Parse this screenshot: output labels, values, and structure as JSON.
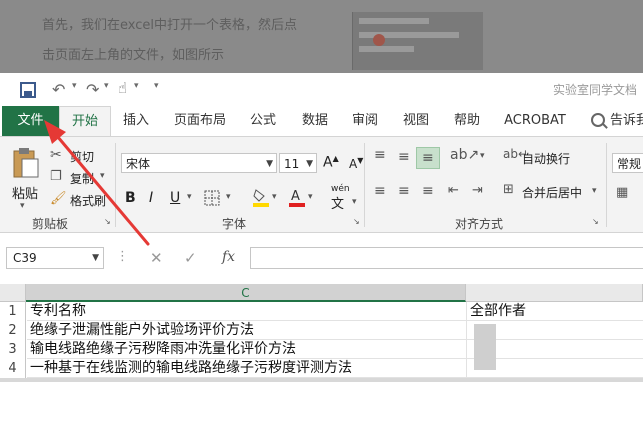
{
  "article": {
    "line1": "首先，我们在excel中打开一个表格，然后点",
    "line2": "击页面左上角的文件，如图所示"
  },
  "window": {
    "title": "实验室同学文档"
  },
  "tabs": [
    "文件",
    "开始",
    "插入",
    "页面布局",
    "公式",
    "数据",
    "审阅",
    "视图",
    "帮助",
    "ACROBAT",
    "告诉我"
  ],
  "clipboard": {
    "paste": "粘贴",
    "cut": "剪切",
    "copy": "复制",
    "format_painter": "格式刷",
    "group_label": "剪贴板"
  },
  "font": {
    "name": "宋体",
    "size": "11",
    "phonetic": "wén",
    "group_label": "字体"
  },
  "alignment": {
    "wrap_text": "自动换行",
    "merge_center": "合并后居中",
    "group_label": "对齐方式"
  },
  "number": {
    "format": "常规"
  },
  "formula_bar": {
    "name_box": "C39",
    "fx": "fx"
  },
  "grid": {
    "columns": [
      "C"
    ],
    "rows": [
      {
        "num": "1",
        "c": "专利名称",
        "d": "全部作者"
      },
      {
        "num": "2",
        "c": "绝缘子泄漏性能户外试验场评价方法",
        "d": ""
      },
      {
        "num": "3",
        "c": "输电线路绝缘子污秽降雨冲洗量化评价方法",
        "d": ""
      },
      {
        "num": "4",
        "c": "一种基于在线监测的输电线路绝缘子污秽度评测方法",
        "d": ""
      }
    ]
  },
  "colors": {
    "accent": "#217346",
    "arrow": "#e53935"
  }
}
